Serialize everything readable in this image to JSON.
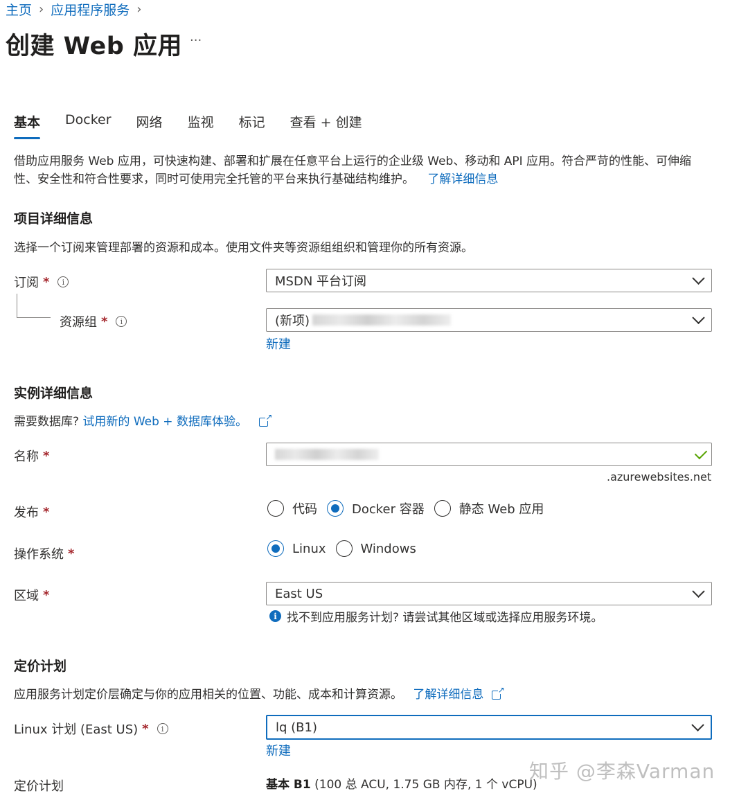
{
  "breadcrumb": {
    "home": "主页",
    "service": "应用程序服务"
  },
  "page": {
    "title": "创建 Web 应用",
    "more": "···"
  },
  "tabs": [
    "基本",
    "Docker",
    "网络",
    "监视",
    "标记",
    "查看 + 创建"
  ],
  "intro": {
    "text": "借助应用服务 Web 应用，可快速构建、部署和扩展在任意平台上运行的企业级 Web、移动和 API 应用。符合严苛的性能、可伸缩性、安全性和符合性要求，同时可使用完全托管的平台来执行基础结构维护。",
    "link": "了解详细信息"
  },
  "project": {
    "title": "项目详细信息",
    "desc": "选择一个订阅来管理部署的资源和成本。使用文件夹等资源组组织和管理你的所有资源。",
    "subscription_label": "订阅",
    "subscription_value": "MSDN 平台订阅",
    "resource_group_label": "资源组",
    "resource_group_value": "(新项)",
    "new_link": "新建"
  },
  "instance": {
    "title": "实例详细信息",
    "db_prefix": "需要数据库?",
    "db_link": "试用新的 Web + 数据库体验。",
    "name_label": "名称",
    "name_suffix": ".azurewebsites.net",
    "publish_label": "发布",
    "publish_options": [
      "代码",
      "Docker 容器",
      "静态 Web 应用"
    ],
    "publish_selected": "Docker 容器",
    "os_label": "操作系统",
    "os_options": [
      "Linux",
      "Windows"
    ],
    "os_selected": "Linux",
    "region_label": "区域",
    "region_value": "East US",
    "region_hint": "找不到应用服务计划? 请尝试其他区域或选择应用服务环境。"
  },
  "pricing": {
    "title": "定价计划",
    "desc": "应用服务计划定价层确定与你的应用相关的位置、功能、成本和计算资源。",
    "link": "了解详细信息",
    "plan_label": "Linux 计划 (East US)",
    "plan_value": "lq (B1)",
    "new_link": "新建",
    "tier_label": "定价计划",
    "tier_name": "基本 B1",
    "tier_detail": "(100 总 ACU, 1.75 GB 内存, 1 个 vCPU)"
  },
  "required_mark": "*",
  "watermark": "知乎 @李森Varman",
  "colors": {
    "accent": "#0f6cbd",
    "required": "#a4262c",
    "success": "#57a300"
  }
}
